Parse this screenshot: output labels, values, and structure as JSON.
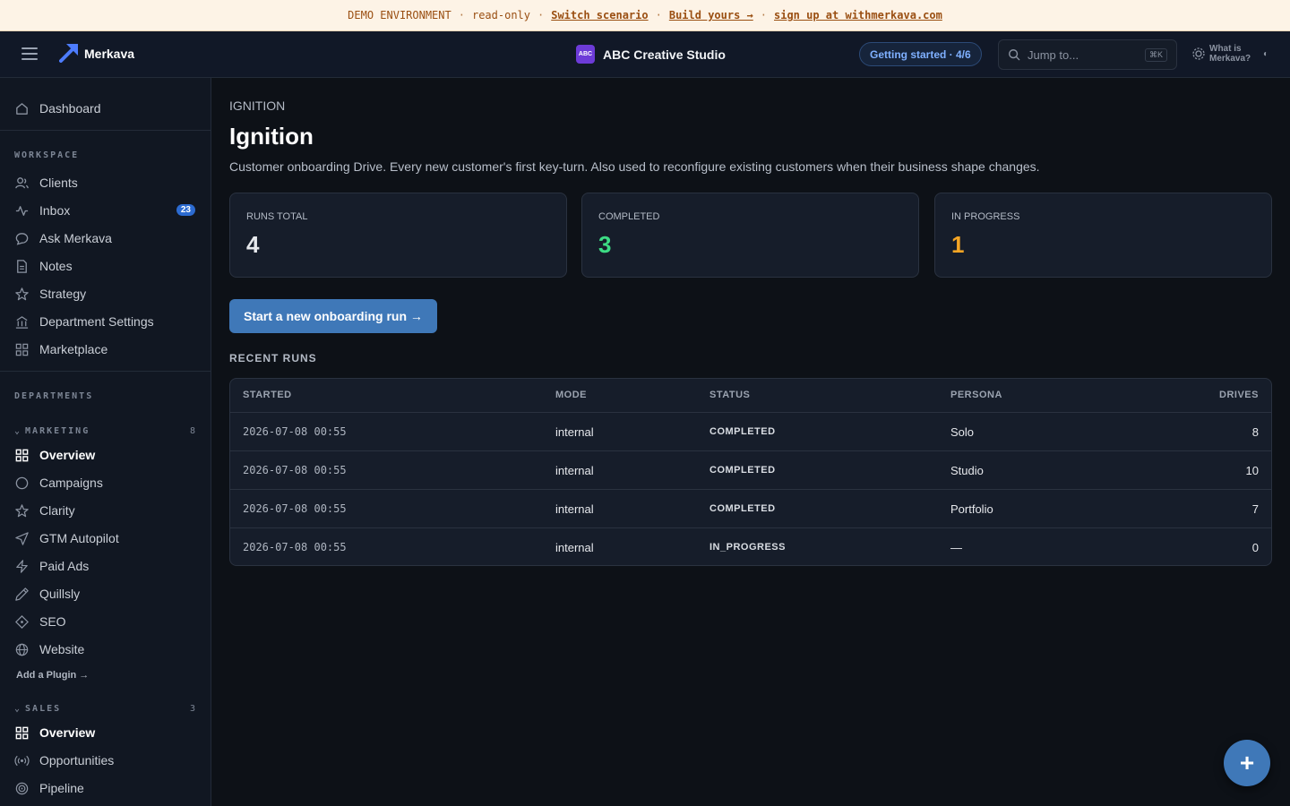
{
  "banner": {
    "env": "DEMO ENVIRONMENT",
    "mode": "read-only",
    "switch_link": "Switch scenario",
    "build_link": "Build yours →",
    "signup_link": "sign up at withmerkava.com",
    "separator": "·"
  },
  "header": {
    "app_name": "Merkava",
    "org_badge": "ABC",
    "org_name": "ABC Creative Studio",
    "getting_started": "Getting started · 4/6",
    "search_placeholder": "Jump to...",
    "search_shortcut": "⌘K",
    "what_is": "What is Merkava?",
    "theme_glyph": "◐"
  },
  "sidebar": {
    "dashboard": "Dashboard",
    "workspace_label": "WORKSPACE",
    "workspace_items": [
      {
        "label": "Clients",
        "icon": "users-icon"
      },
      {
        "label": "Inbox",
        "icon": "activity-icon",
        "badge": "23"
      },
      {
        "label": "Ask Merkava",
        "icon": "chat-icon"
      },
      {
        "label": "Notes",
        "icon": "document-icon"
      },
      {
        "label": "Strategy",
        "icon": "star-icon"
      },
      {
        "label": "Department Settings",
        "icon": "building-icon"
      },
      {
        "label": "Marketplace",
        "icon": "grid-icon"
      }
    ],
    "departments_label": "DEPARTMENTS",
    "marketing": {
      "label": "MARKETING",
      "count": "8",
      "items": [
        {
          "label": "Overview",
          "icon": "grid-icon"
        },
        {
          "label": "Campaigns",
          "icon": "circle-icon"
        },
        {
          "label": "Clarity",
          "icon": "star-icon"
        },
        {
          "label": "GTM Autopilot",
          "icon": "send-icon"
        },
        {
          "label": "Paid Ads",
          "icon": "bolt-icon"
        },
        {
          "label": "Quillsly",
          "icon": "pen-icon"
        },
        {
          "label": "SEO",
          "icon": "diamond-icon"
        },
        {
          "label": "Website",
          "icon": "globe-icon"
        }
      ]
    },
    "add_plugin": "Add a Plugin →",
    "sales": {
      "label": "SALES",
      "count": "3",
      "items": [
        {
          "label": "Overview",
          "icon": "grid-icon"
        },
        {
          "label": "Opportunities",
          "icon": "broadcast-icon"
        },
        {
          "label": "Pipeline",
          "icon": "target-icon"
        }
      ]
    }
  },
  "main": {
    "eyebrow": "IGNITION",
    "title": "Ignition",
    "description": "Customer onboarding Drive. Every new customer's first key-turn. Also used to reconfigure existing customers when their business shape changes.",
    "stats": [
      {
        "label": "RUNS TOTAL",
        "value": "4",
        "color": "#e6e8ec"
      },
      {
        "label": "COMPLETED",
        "value": "3",
        "color": "#3ddc84"
      },
      {
        "label": "IN PROGRESS",
        "value": "1",
        "color": "#f5a524"
      }
    ],
    "new_run_button": "Start a new onboarding run →",
    "recent_label": "RECENT RUNS",
    "table": {
      "headers": {
        "started": "STARTED",
        "mode": "MODE",
        "status": "STATUS",
        "persona": "PERSONA",
        "drives": "DRIVES"
      },
      "rows": [
        {
          "started": "2026-07-08 00:55",
          "mode": "internal",
          "status": "COMPLETED",
          "persona": "Solo",
          "drives": "8"
        },
        {
          "started": "2026-07-08 00:55",
          "mode": "internal",
          "status": "COMPLETED",
          "persona": "Studio",
          "drives": "10"
        },
        {
          "started": "2026-07-08 00:55",
          "mode": "internal",
          "status": "COMPLETED",
          "persona": "Portfolio",
          "drives": "7"
        },
        {
          "started": "2026-07-08 00:55",
          "mode": "internal",
          "status": "IN_PROGRESS",
          "persona": "—",
          "drives": "0"
        }
      ]
    }
  },
  "fab": {
    "label": "+"
  },
  "colors": {
    "accent": "#3f78b8",
    "completed": "#3ddc84",
    "in_progress": "#f5a524",
    "banner_text": "#9a4f12"
  }
}
